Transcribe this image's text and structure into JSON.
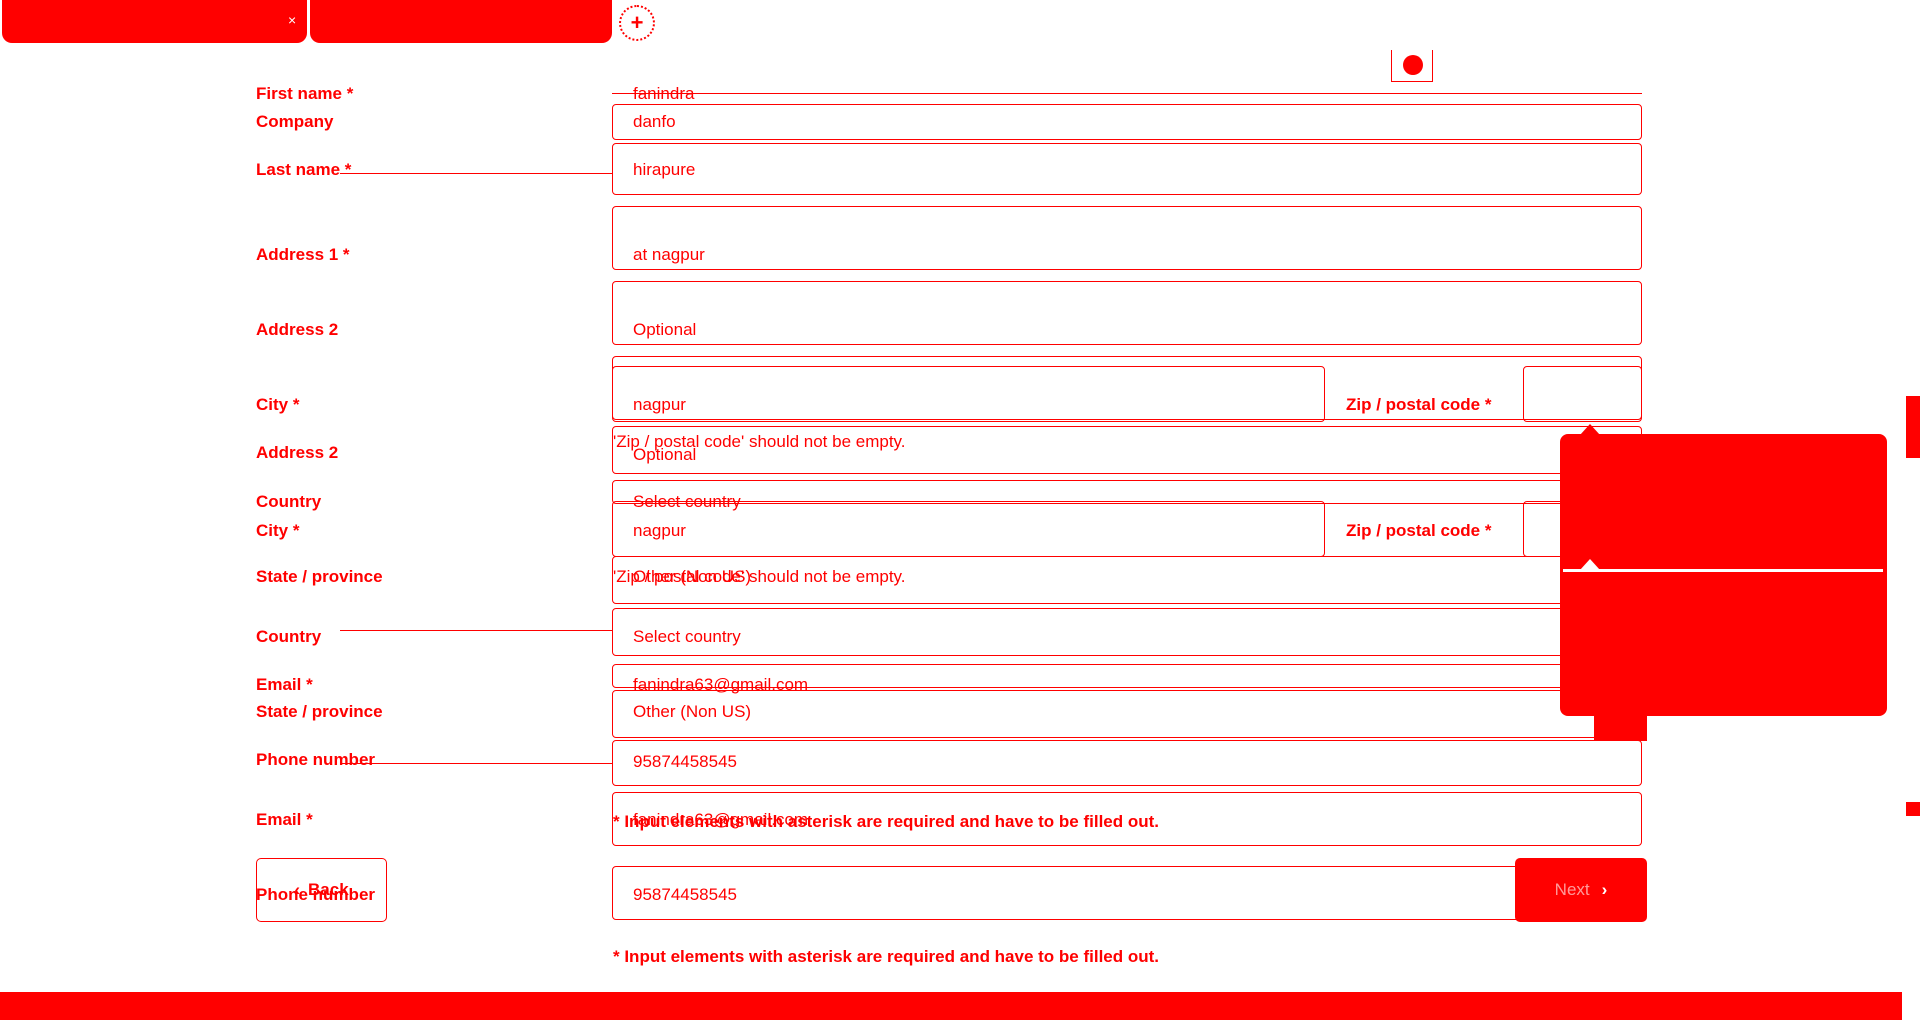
{
  "tabs": [
    {
      "label": "",
      "close_glyph": "×"
    },
    {
      "label": ""
    }
  ],
  "new_tab_glyph": "+",
  "form_layer_a": {
    "first_name_label": "First name *",
    "first_name_value": "fanindra",
    "company_label": "Company",
    "company_value": "danfo",
    "last_name_label": "Last name *",
    "last_name_value": "hirapure",
    "address1_label": "Address 1 *",
    "address1_value": "at nagpur",
    "address2_label": "Address 2",
    "address2_placeholder": "Optional",
    "city_label": "City *",
    "city_value": "nagpur",
    "zip_label": "Zip / postal code *",
    "zip_error": "'Zip / postal code' should not be empty.",
    "country_label": "Country",
    "country_value": "Select country",
    "state_label": "State / province",
    "state_value": "Other (Non US)",
    "email_label": "Email *",
    "email_value": "fanindra63@gmail.com",
    "phone_label": "Phone number",
    "phone_value": "95874458545",
    "required_note": "* Input elements with asterisk are required and have to be filled out."
  },
  "form_layer_b": {
    "first_name_label": "First name *",
    "first_name_value": "fanindra",
    "last_name_label": "Last name *",
    "last_name_value": "hirapure",
    "address1_label": "Address 1 *",
    "address1_value": "at nagpur",
    "address2_label": "Address 2",
    "address2_placeholder": "Optional",
    "city_label": "City *",
    "city_value": "nagpur",
    "zip_label": "Zip / postal code *",
    "zip_error": "'Zip / postal code' should not be empty.",
    "country_label": "Country",
    "country_value": "Select country",
    "state_label": "State / province",
    "state_value": "Other (Non US)",
    "email_label": "Email *",
    "email_value": "fanindra63@gmail.com",
    "phone_label": "Phone number",
    "phone_value": "95874458545",
    "required_note": "* Input elements with asterisk are required and have to be filled out."
  },
  "buttons": {
    "back_label": "Back",
    "back_glyph": "‹",
    "next_label": "Next",
    "next_glyph": "›"
  },
  "icons": {
    "record": "record-icon",
    "close": "close-icon",
    "add": "plus-icon"
  },
  "colors": {
    "accent": "#ff0000",
    "background": "#ffffff"
  }
}
